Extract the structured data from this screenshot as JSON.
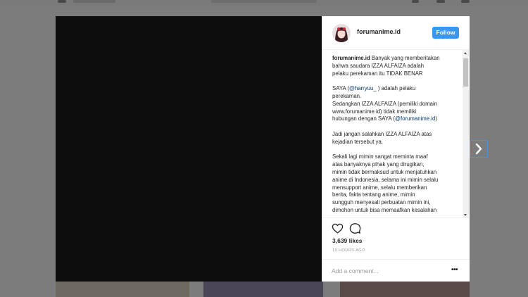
{
  "post": {
    "username": "forumanime.id",
    "follow_label": "Follow",
    "caption": {
      "p1_user": "forumanime.id",
      "p1_lines": [
        " Banyak yang memberitakan",
        "bahwa saudara IZZA ALFAIZA adalah",
        "pelaku perekaman itu TIDAK BENAR"
      ],
      "p2_line1_prefix": "SAYA (",
      "p2_line1_mention": "@harryuu_",
      "p2_line1_suffix": " ) adalah pelaku",
      "p2_lines": [
        "perekaman.",
        "Sedangkan IZZA ALFAIZA (pemiliki domain",
        "www.forumanime.id) tidak memiliki"
      ],
      "p2_last_prefix": "hubungan dengan SAYA (",
      "p2_last_mention": "@forumanime.id",
      "p2_last_suffix": ")",
      "p3_lines": [
        "Jadi jangan salahkan IZZA ALFAIZA atas",
        "kejadian tersebut ya."
      ],
      "p4_lines": [
        "Sekali lagi mimin sangat meminta maaf",
        "atas banyaknya pihak yang dirugikan,",
        "mimin tidak bermaksud untuk menjatuhkan",
        "anime di Indonesia, selama ini mimin selalu",
        "mensupport anime, selalu memberikan",
        "berita, fakta tentang anime, mimin",
        "sungguh menyesali perbuatan mimin ini,",
        "dimohon untuk bisa memaafkan kesalahan"
      ]
    },
    "likes": "3,639 likes",
    "timestamp": "19 HOURS AGO",
    "comment_placeholder": "Add a comment...",
    "more_label": "•••"
  },
  "icons": {
    "like": "heart-icon",
    "comment": "speech-bubble-icon",
    "next": "chevron-right-icon"
  },
  "colors": {
    "follow": "#3897f0",
    "link": "#003569",
    "overlay": "#7c7c7c"
  }
}
